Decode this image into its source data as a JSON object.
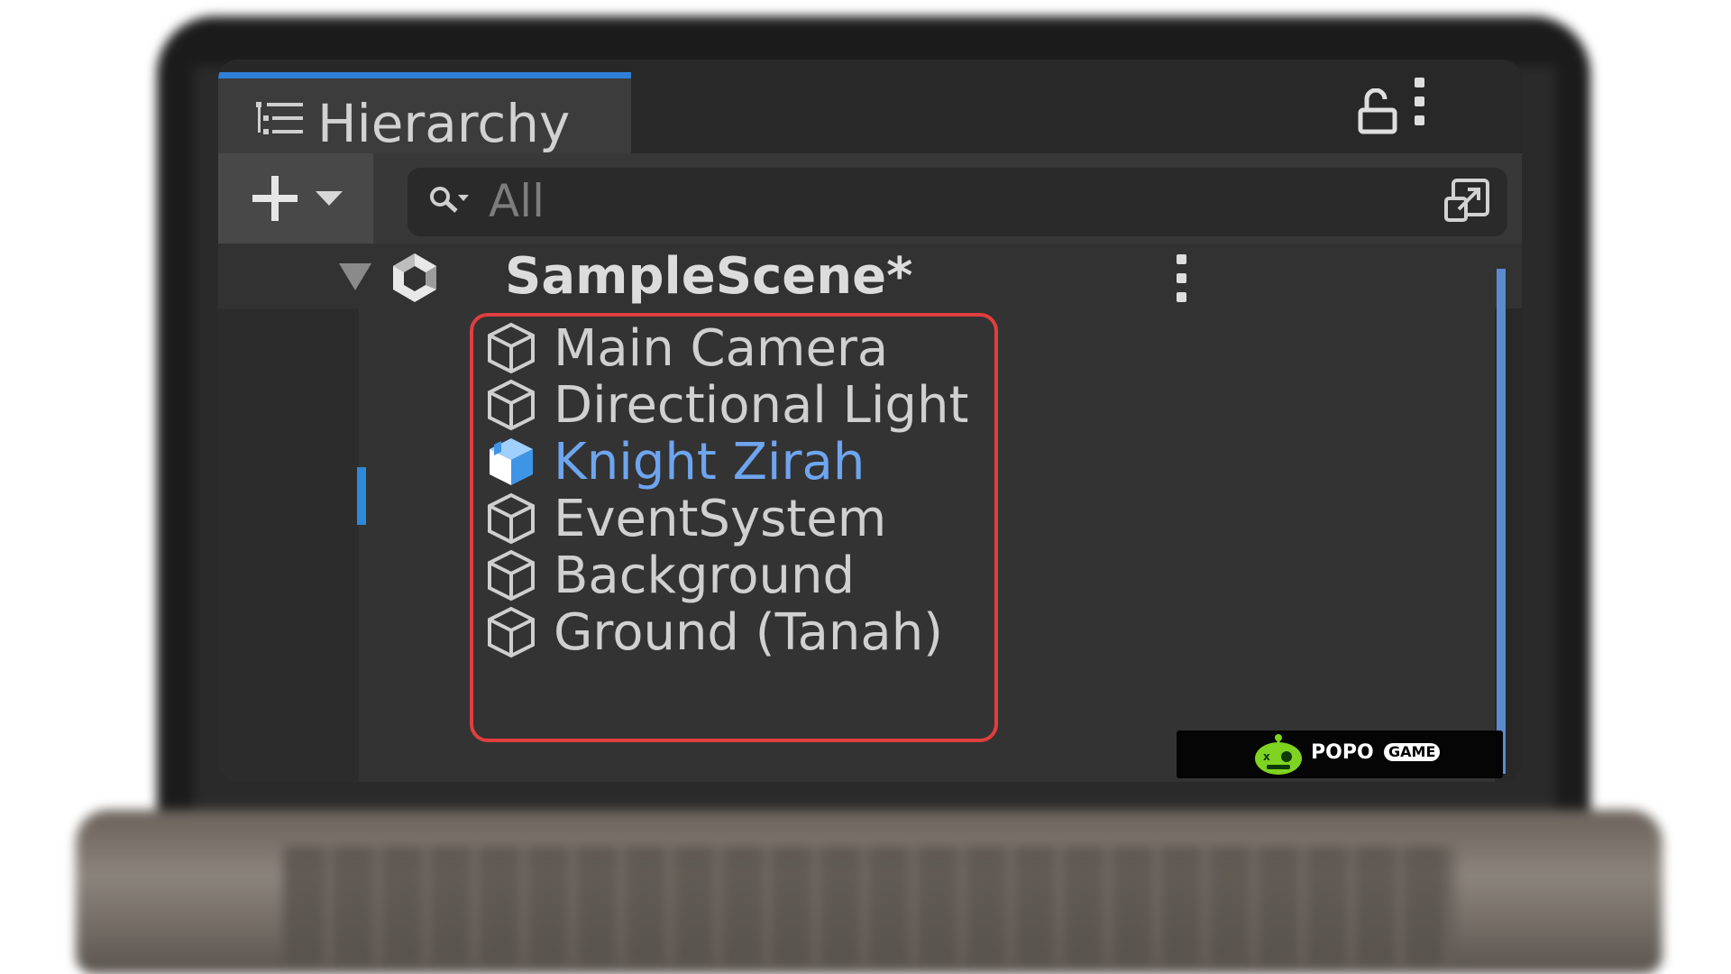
{
  "panel": {
    "tab_title": "Hierarchy",
    "accent_color": "#2f7fd6"
  },
  "toolbar": {
    "add_icon": "plus-icon",
    "search_placeholder": "All"
  },
  "scene": {
    "title": "SampleScene*",
    "icon": "unity-logo-icon"
  },
  "hierarchy": {
    "items": [
      {
        "label": "Main Camera",
        "icon": "gameobject-cube-icon",
        "selected": false
      },
      {
        "label": "Directional Light",
        "icon": "gameobject-cube-icon",
        "selected": false
      },
      {
        "label": "Knight Zirah",
        "icon": "prefab-cube-icon",
        "selected": true
      },
      {
        "label": "EventSystem",
        "icon": "gameobject-cube-icon",
        "selected": false
      },
      {
        "label": "Background",
        "icon": "gameobject-cube-icon",
        "selected": false
      },
      {
        "label": "Ground (Tanah)",
        "icon": "gameobject-cube-icon",
        "selected": false
      }
    ],
    "highlight_color": "#e13e3e",
    "selected_color": "#6ea5ef"
  },
  "watermark": {
    "brand": "POPO",
    "badge": "GAME"
  }
}
